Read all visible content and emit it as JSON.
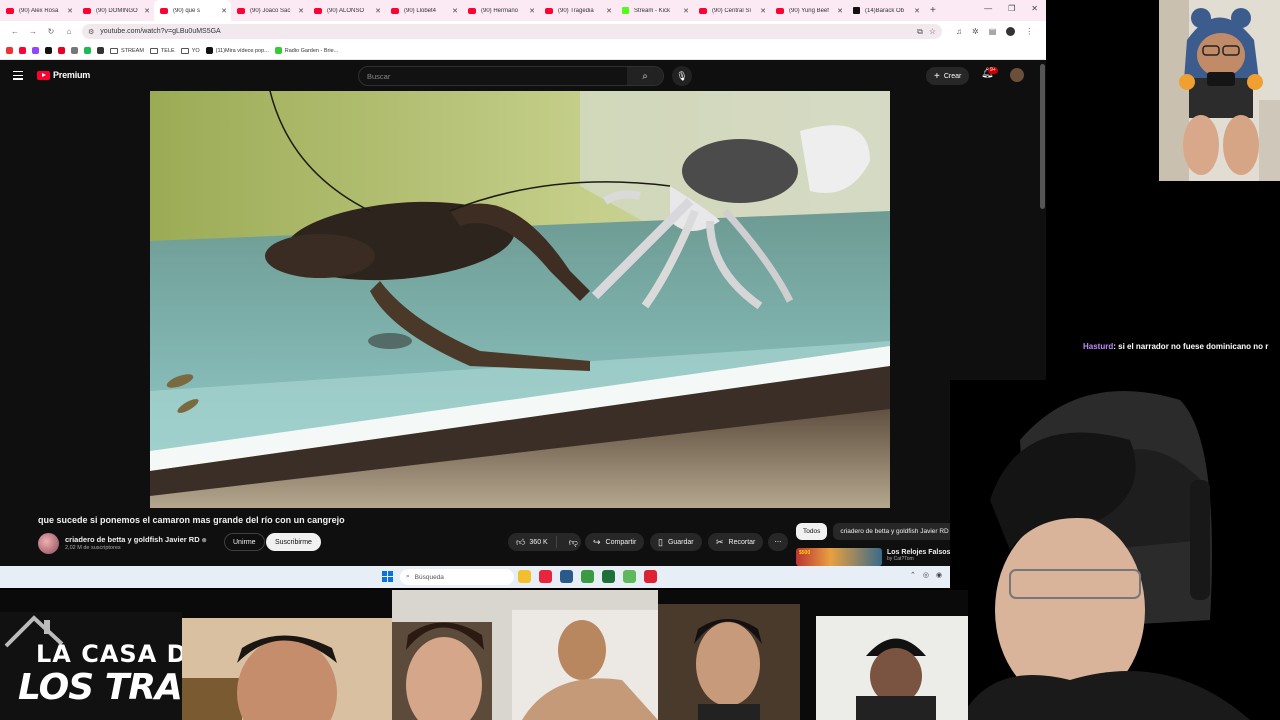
{
  "browser": {
    "tabs": [
      {
        "label": "(90) Alex Rosa",
        "icon": "youtube",
        "active": false
      },
      {
        "label": "(90) DOMINGO",
        "icon": "youtube",
        "active": false
      },
      {
        "label": "(90) que s",
        "icon": "youtube",
        "active": true
      },
      {
        "label": "(90) Joaco Sac",
        "icon": "youtube",
        "active": false
      },
      {
        "label": "(90) ALONSO",
        "icon": "youtube",
        "active": false
      },
      {
        "label": "(90) Llobet4",
        "icon": "youtube",
        "active": false
      },
      {
        "label": "(90) Hermano",
        "icon": "youtube",
        "active": false
      },
      {
        "label": "(90) Tragedia",
        "icon": "youtube",
        "active": false
      },
      {
        "label": "Stream - Kick",
        "icon": "kick",
        "active": false
      },
      {
        "label": "(90) Central Sí",
        "icon": "youtube",
        "active": false
      },
      {
        "label": "(90) Yung Beef",
        "icon": "youtube",
        "active": false
      },
      {
        "label": "(14)Barack Ob",
        "icon": "tiktok",
        "active": false
      }
    ],
    "new_tab": "+",
    "url": "youtube.com/watch?v=gLBu0uMS5GA",
    "bookmarks": [
      {
        "label": "",
        "type": "icon",
        "color": "#e33"
      },
      {
        "label": "",
        "type": "icon",
        "color": "#ff0033"
      },
      {
        "label": "",
        "type": "icon",
        "color": "#9146ff"
      },
      {
        "label": "",
        "type": "icon",
        "color": "#111"
      },
      {
        "label": "",
        "type": "icon",
        "color": "#e60023"
      },
      {
        "label": "",
        "type": "icon",
        "color": "#777"
      },
      {
        "label": "",
        "type": "icon",
        "color": "#1db954"
      },
      {
        "label": "",
        "type": "icon",
        "color": "#333"
      },
      {
        "label": "STREAM",
        "type": "folder"
      },
      {
        "label": "TELE",
        "type": "folder"
      },
      {
        "label": "YO",
        "type": "folder"
      },
      {
        "label": "(11)Mira vídeos pop...",
        "type": "icon",
        "color": "#111"
      },
      {
        "label": "Radio Garden - Brie...",
        "type": "icon",
        "color": "#3c3"
      }
    ]
  },
  "youtube": {
    "logo_text": "Premium",
    "search_placeholder": "Buscar",
    "create_label": "Crear",
    "notif_count": "9+",
    "video_title": "que sucede si ponemos el camaron mas grande del río con un cangrejo",
    "channel_name": "criadero de betta y goldfish Javier RD",
    "subscribers": "2,02 M de suscriptores",
    "join_label": "Unirme",
    "subscribe_label": "Suscribirme",
    "likes": "360 K",
    "share_label": "Compartir",
    "save_label": "Guardar",
    "clip_label": "Recortar",
    "chips": [
      "Todos",
      "criadero de betta y goldfish Javier RD"
    ],
    "rec_title": "Los Relojes Falsos de",
    "rec_channel": "by Cat?Tom",
    "rec_thumb_text": "$500"
  },
  "taskbar": {
    "search_label": "Búsqueda",
    "apps": [
      "#f2c02f",
      "#e8253c",
      "#2a5a8a",
      "#3c9a42",
      "#1f6f3a",
      "#5fb85a",
      "#d23"
    ]
  },
  "stream": {
    "chat_user": "Hasturd",
    "chat_message": ": si el narrador no fuese dominicano no r",
    "banner_line1": "LA CASA D",
    "banner_line2": "LOS TRAVELO"
  }
}
